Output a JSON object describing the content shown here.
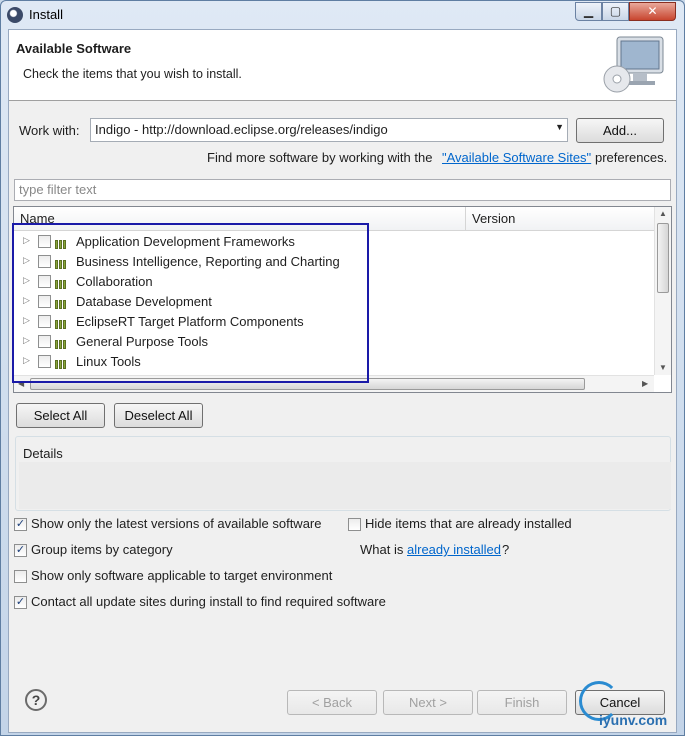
{
  "window": {
    "title": "Install",
    "min_glyph": "▁",
    "max_glyph": "▢",
    "close_glyph": "✕"
  },
  "header": {
    "title": "Available Software",
    "description": "Check the items that you wish to install."
  },
  "work_with": {
    "label": "Work with:",
    "value": "Indigo - http://download.eclipse.org/releases/indigo",
    "add_button": "Add..."
  },
  "sites_line": {
    "prefix": "Find more software by working with the",
    "link": "\"Available Software Sites\"",
    "suffix": "preferences."
  },
  "filter": {
    "placeholder": "type filter text"
  },
  "table": {
    "columns": [
      "Name",
      "Version"
    ],
    "rows": [
      {
        "label": "Application Development Frameworks"
      },
      {
        "label": "Business Intelligence, Reporting and Charting"
      },
      {
        "label": "Collaboration"
      },
      {
        "label": "Database Development"
      },
      {
        "label": "EclipseRT Target Platform Components"
      },
      {
        "label": "General Purpose Tools"
      },
      {
        "label": "Linux Tools"
      }
    ]
  },
  "selection_buttons": {
    "select_all": "Select All",
    "deselect_all": "Deselect All"
  },
  "details": {
    "label": "Details"
  },
  "options": {
    "latest_versions": {
      "label": "Show only the latest versions of available software",
      "checked": true
    },
    "hide_installed": {
      "label": "Hide items that are already installed",
      "checked": false
    },
    "group_by_category": {
      "label": "Group items by category",
      "checked": true
    },
    "what_is_prefix": "What is",
    "what_is_link": "already installed",
    "what_is_suffix": "?",
    "target_env": {
      "label": "Show only software applicable to target environment",
      "checked": false
    },
    "contact_sites": {
      "label": "Contact all update sites during install to find required software",
      "checked": true
    }
  },
  "footer": {
    "back": "< Back",
    "next": "Next >",
    "finish": "Finish",
    "cancel": "Cancel",
    "help_glyph": "?"
  },
  "watermark": {
    "text": "iyunv.com"
  },
  "colors": {
    "accent": "#0066cc",
    "highlight_box": "#1a1aa8"
  }
}
